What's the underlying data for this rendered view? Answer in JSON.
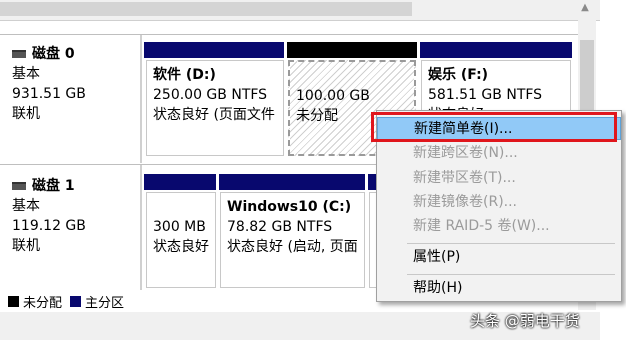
{
  "top_scrollbar": {
    "arrow": "▲"
  },
  "disks": [
    {
      "title": "磁盘 0",
      "type": "基本",
      "size": "931.51 GB",
      "status": "联机",
      "partitions": [
        {
          "name": "软件  (D:)",
          "size": "250.00 GB NTFS",
          "status": "状态良好 (页面文件"
        },
        {
          "name": "",
          "size": "100.00 GB",
          "status": "未分配"
        },
        {
          "name": "娱乐  (F:)",
          "size": "581.51 GB NTFS",
          "status": "状态良好"
        }
      ]
    },
    {
      "title": "磁盘 1",
      "type": "基本",
      "size": "119.12 GB",
      "status": "联机",
      "partitions": [
        {
          "name": "",
          "size": "300 MB",
          "status": "状态良好"
        },
        {
          "name": "Windows10  (C:)",
          "size": "78.82 GB NTFS",
          "status": "状态良好 (启动, 页面"
        },
        {
          "name": "",
          "size": "",
          "status": ""
        }
      ]
    }
  ],
  "legend": [
    {
      "label": "未分配",
      "color": "#000000"
    },
    {
      "label": "主分区",
      "color": "#08086e"
    }
  ],
  "context_menu": {
    "items": [
      {
        "label": "新建简单卷(I)...",
        "enabled": true,
        "highlighted": true
      },
      {
        "label": "新建跨区卷(N)...",
        "enabled": false
      },
      {
        "label": "新建带区卷(T)...",
        "enabled": false
      },
      {
        "label": "新建镜像卷(R)...",
        "enabled": false
      },
      {
        "label": "新建 RAID-5 卷(W)...",
        "enabled": false
      },
      {
        "label": "属性(P)",
        "enabled": true
      },
      {
        "label": "帮助(H)",
        "enabled": true
      }
    ]
  },
  "watermark": "头条 @弱电干货"
}
